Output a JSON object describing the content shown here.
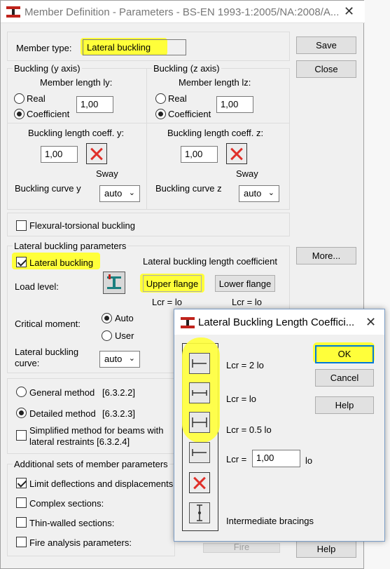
{
  "window": {
    "title": "Member Definition - Parameters - BS-EN 1993-1:2005/NA:2008/A...",
    "close": "✕"
  },
  "member_type": {
    "label": "Member type:",
    "value": "Lateral buckling"
  },
  "buttons": {
    "save": "Save",
    "close": "Close",
    "more": "More...",
    "help": "Help",
    "fire": "Fire"
  },
  "buckling_y": {
    "legend": "Buckling (y axis)",
    "member_length_label": "Member length ly:",
    "real_label": "Real",
    "coefficient_label": "Coefficient",
    "length_value": "1,00",
    "coeff_label": "Buckling length coeff. y:",
    "coeff_value": "1,00",
    "sway_label": "Sway",
    "curve_label": "Buckling curve y",
    "curve_value": "auto"
  },
  "buckling_z": {
    "legend": "Buckling (z axis)",
    "member_length_label": "Member length lz:",
    "real_label": "Real",
    "coefficient_label": "Coefficient",
    "length_value": "1,00",
    "coeff_label": "Buckling length coeff. z:",
    "coeff_value": "1,00",
    "sway_label": "Sway",
    "curve_label": "Buckling curve z",
    "curve_value": "auto"
  },
  "flexural_torsional": {
    "label": "Flexural-torsional buckling"
  },
  "lateral": {
    "legend": "Lateral buckling parameters",
    "checkbox_label": "Lateral buckling",
    "length_coeff_label": "Lateral buckling length coefficient",
    "load_level_label": "Load level:",
    "upper_flange": "Upper flange",
    "lower_flange": "Lower flange",
    "lcr_upper": "Lcr  =  lo",
    "lcr_lower": "Lcr  =  lo",
    "critical_moment_label": "Critical moment:",
    "auto_label": "Auto",
    "user_label": "User",
    "curve_label_1": "Lateral buckling",
    "curve_label_2": "curve:",
    "curve_value": "auto"
  },
  "methods": {
    "general": "General method",
    "general_ref": "[6.3.2.2]",
    "detailed": "Detailed method",
    "detailed_ref": "[6.3.2.3]",
    "simplified_1": "Simplified method for beams with",
    "simplified_2": "lateral restraints [6.3.2.4]"
  },
  "additional": {
    "legend": "Additional sets of member parameters",
    "limit": "Limit deflections and displacements:",
    "complex": "Complex sections:",
    "thin": "Thin-walled sections:",
    "fire": "Fire analysis parameters:"
  },
  "popup": {
    "title": "Lateral Buckling Length Coeffici...",
    "close": "✕",
    "ok": "OK",
    "cancel": "Cancel",
    "help": "Help",
    "opt1": "Lcr = 2 lo",
    "opt2": "Lcr = lo",
    "opt3": "Lcr = 0.5 lo",
    "opt4_prefix": "Lcr  =",
    "opt4_value": "1,00",
    "opt4_suffix": "lo",
    "intermediate": "Intermediate bracings"
  },
  "colors": {
    "highlight": "#ffff3a",
    "red_x": "#e0302a",
    "focus": "#0078d7"
  }
}
